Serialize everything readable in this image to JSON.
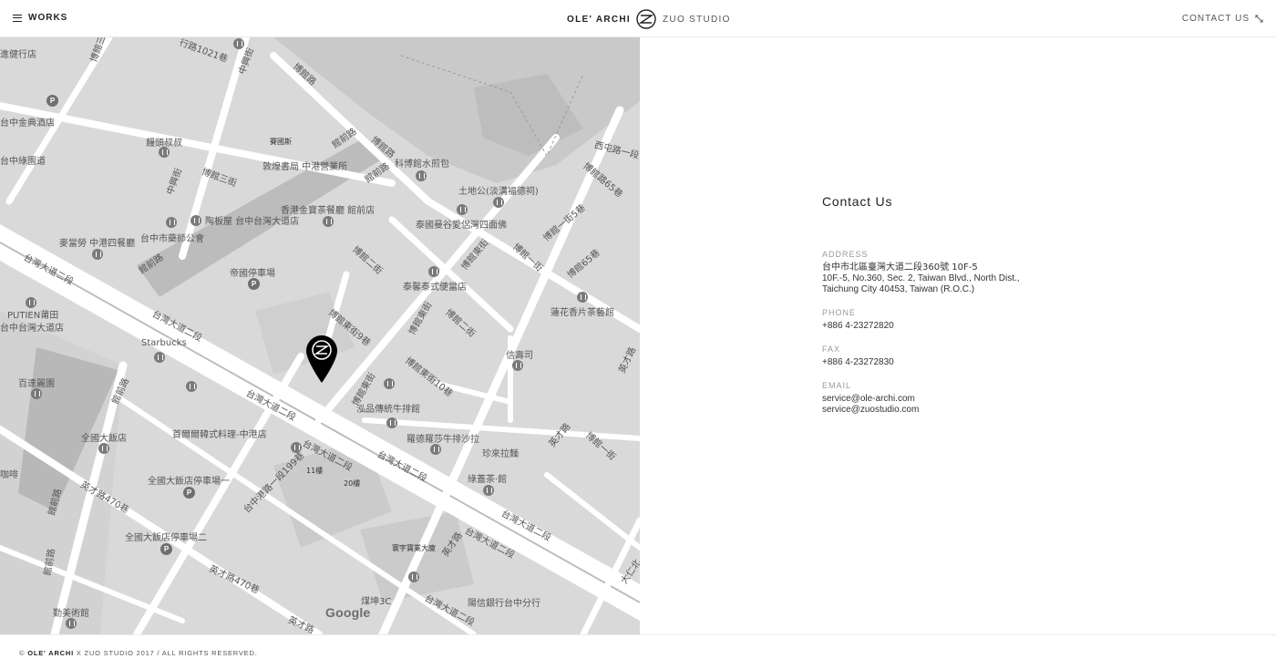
{
  "header": {
    "works_label": "WORKS",
    "brand_left": "OLE' ARCHI",
    "brand_right": "ZUO STUDIO",
    "contact_label": "CONTACT US"
  },
  "map": {
    "provider_label": "Google",
    "labels": [
      "博館三街",
      "進健行店",
      "行路1021巷",
      "中興街",
      "博館路",
      "台中金典酒店",
      "饅頭叔叔",
      "賽國斯",
      "館前路",
      "敦煌書局 中港營業所",
      "館前路",
      "科博館水煎包",
      "博館路",
      "西屯路一段",
      "博館路65巷",
      "台中綠園道",
      "博館三街",
      "中興街",
      "土地公(淡溝福德祠)",
      "香港金寶茶餐廳 館前店",
      "陶板屋 台中台灣大道店",
      "泰國曼谷愛侶灣四面佛",
      "博館一街5巷",
      "台中市藥師公會",
      "麥當勞 中港四餐廳",
      "館前路",
      "博館東街",
      "博館一街",
      "博館65巷",
      "台灣大道二段",
      "帝國停車場",
      "博館二街",
      "泰馨泰式便當店",
      "蓮花香片茶藝館",
      "PUTIEN莆田",
      "台中台灣大道店",
      "台灣大道二段",
      "博館東街",
      "博館東街9巷",
      "博館二街",
      "Starbucks",
      "信壽司",
      "英才路",
      "百達麗園",
      "博館東街",
      "博館東街10巷",
      "泓品傳統牛排館",
      "館前路",
      "英才路",
      "博館一街",
      "台灣大道二段",
      "首爾爾韓式料理-中港店",
      "全國大飯店",
      "台灣大道二段",
      "羅德羅莎牛排沙拉",
      "台灣大道二段",
      "珍來拉麵",
      "台中港路一段199巷",
      "11樓",
      "20樓",
      "綠蓋茶·館",
      "咖啡",
      "全國大飯店停車場一",
      "英才路470巷",
      "台灣大道二段",
      "館前路",
      "全國大飯店停車場二",
      "寰宇寶業大廈",
      "英才路",
      "台灣大道二段",
      "英才路470巷",
      "館前路",
      "煤坤3C",
      "勤美術館",
      "陽信銀行台中分行",
      "英才路",
      "台灣大道二段",
      "大仁北"
    ]
  },
  "contact": {
    "title": "Contact Us",
    "address_label": "ADDRESS",
    "address_zh": "台中市北區臺灣大道二段360號  10F-5",
    "address_en_1": "10F.-5, No.360, Sec. 2, Taiwan Blvd., North Dist.,",
    "address_en_2": "Taichung City 40453, Taiwan (R.O.C.)",
    "phone_label": "PHONE",
    "phone": "+886 4-23272820",
    "fax_label": "FAX",
    "fax": "+886 4-23272830",
    "email_label": "EMAIL",
    "email_1": "service@ole-archi.com",
    "email_2": "service@zuostudio.com"
  },
  "footer": {
    "brand": "OLE' ARCHI",
    "text": " X ZUO STUDIO 2017 / ALL RIGHTS RESERVED."
  },
  "colors": {
    "map_bg": "#d9d9d9",
    "road": "#ffffff",
    "block": "#cfcfcf",
    "park": "#c4c4c4",
    "pin": "#000000"
  }
}
